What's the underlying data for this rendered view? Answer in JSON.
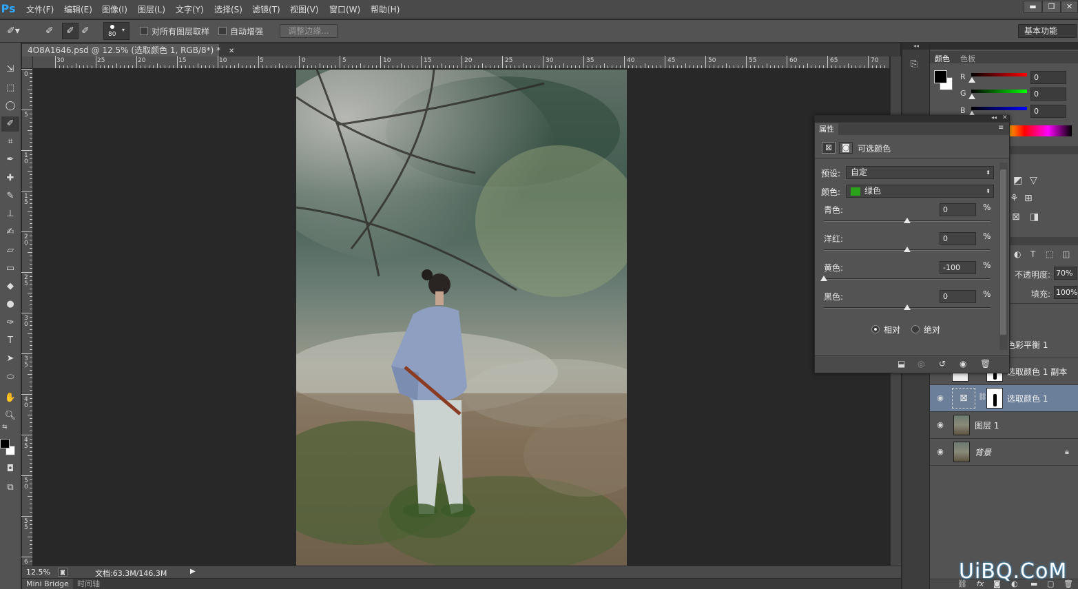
{
  "app": {
    "logo": "Ps"
  },
  "menu": [
    "文件(F)",
    "编辑(E)",
    "图像(I)",
    "图层(L)",
    "文字(Y)",
    "选择(S)",
    "滤镜(T)",
    "视图(V)",
    "窗口(W)",
    "帮助(H)"
  ],
  "window_buttons": [
    "▬",
    "❐",
    "✕"
  ],
  "options": {
    "brush_size": "80",
    "sample_all_layers": "对所有图层取样",
    "auto_enhance": "自动增强",
    "refine_edge": "调整边缘...",
    "workspace": "基本功能"
  },
  "document": {
    "tab_title": "4O8A1646.psd @ 12.5% (选取颜色 1, RGB/8*) *",
    "close": "✕"
  },
  "ruler": {
    "h_labels": [
      "30",
      "25",
      "20",
      "15",
      "10",
      "5",
      "0",
      "5",
      "10",
      "15",
      "20",
      "25",
      "30",
      "35",
      "40",
      "45",
      "50",
      "55",
      "60",
      "65",
      "70"
    ],
    "v_labels": [
      "0",
      "5",
      "1 0",
      "1 5",
      "2 0",
      "2 5",
      "3 0",
      "3 5",
      "4 0",
      "4 5",
      "5 0",
      "5 5",
      "6"
    ]
  },
  "status": {
    "zoom": "12.5%",
    "doc_info": "文档:63.3M/146.3M"
  },
  "bottom_tabs": [
    "Mini Bridge",
    "时间轴"
  ],
  "color_panel": {
    "tabs": [
      "颜色",
      "色板"
    ],
    "channels": [
      {
        "label": "R",
        "value": "0",
        "color": "#d01010"
      },
      {
        "label": "G",
        "value": "0",
        "color": "#10c010"
      },
      {
        "label": "B",
        "value": "0",
        "color": "#1010d0"
      }
    ]
  },
  "layers_panel": {
    "opacity_label": "不透明度:",
    "opacity_value": "70%",
    "fill_label": "填充:",
    "fill_value": "100%",
    "layers": [
      {
        "name": "色彩平衡 1",
        "visible": false,
        "selected": false
      },
      {
        "name": "选取颜色 1 副本",
        "visible": false,
        "selected": false
      },
      {
        "name": "选取颜色 1",
        "visible": true,
        "selected": true
      },
      {
        "name": "图层 1",
        "visible": true,
        "selected": false
      },
      {
        "name": "背景",
        "visible": true,
        "selected": false
      }
    ]
  },
  "properties": {
    "tab": "属性",
    "title": "可选颜色",
    "preset_label": "预设:",
    "preset_value": "自定",
    "color_label": "颜色:",
    "color_value": "绿色",
    "color_swatch": "#2aa21a",
    "sliders": [
      {
        "label": "青色:",
        "value": "0",
        "unit": "%",
        "pos": 0.5
      },
      {
        "label": "洋红:",
        "value": "0",
        "unit": "%",
        "pos": 0.5
      },
      {
        "label": "黄色:",
        "value": "-100",
        "unit": "%",
        "pos": 0.0
      },
      {
        "label": "黑色:",
        "value": "0",
        "unit": "%",
        "pos": 0.5
      }
    ],
    "mode_relative": "相对",
    "mode_absolute": "绝对",
    "mode_selected": "relative"
  },
  "watermark": "UiBQ.CoM"
}
